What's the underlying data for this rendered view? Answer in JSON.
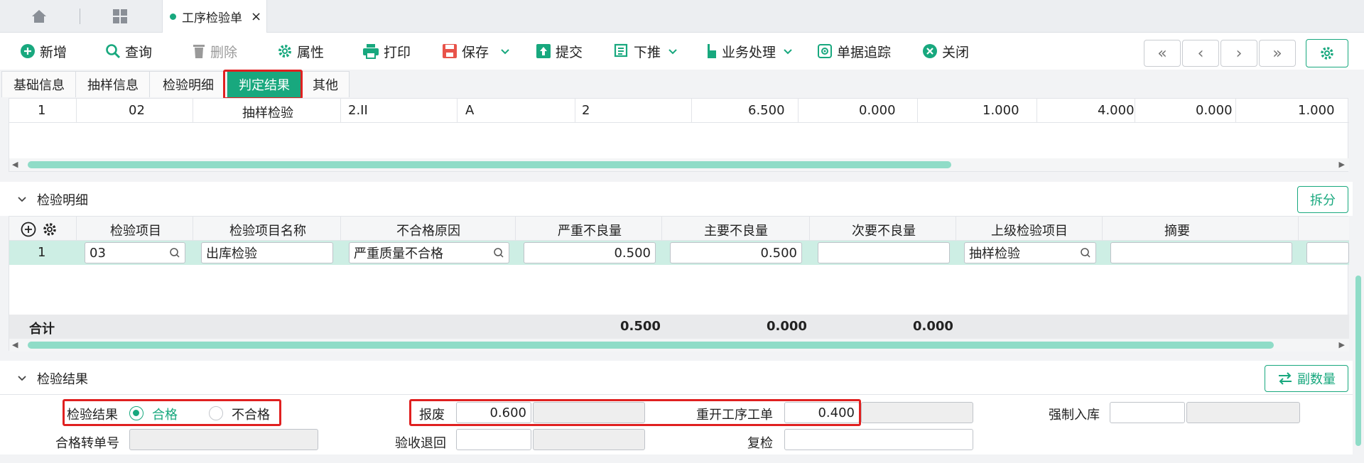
{
  "colors": {
    "accent": "#18a87e",
    "highlight": "#e02020"
  },
  "tabbar": {
    "doc_tab_label": "工序检验单",
    "close_glyph": "×"
  },
  "toolbar": {
    "new": "新增",
    "query": "查询",
    "delete": "删除",
    "props": "属性",
    "print": "打印",
    "save": "保存",
    "submit": "提交",
    "push": "下推",
    "business": "业务处理",
    "trace": "单据追踪",
    "close": "关闭"
  },
  "subtabs": [
    "基础信息",
    "抽样信息",
    "检验明细",
    "判定结果",
    "其他"
  ],
  "sampling_row": {
    "cells": [
      "1",
      "02",
      "抽样检验",
      "2.II",
      "A",
      "2",
      "6.500",
      "0.000",
      "1.000",
      "4.000",
      "0.000",
      "1.000"
    ]
  },
  "detail_section": {
    "title": "检验明细",
    "split_button": "拆分",
    "headers": [
      "检验项目",
      "检验项目名称",
      "不合格原因",
      "严重不良量",
      "主要不良量",
      "次要不良量",
      "上级检验项目",
      "摘要"
    ],
    "row": {
      "seq": "1",
      "item_code": "03",
      "item_name": "出库检验",
      "reason": "严重质量不合格",
      "serious_qty": "0.500",
      "main_qty": "0.500",
      "minor_qty": "",
      "parent_item": "抽样检验",
      "summary": ""
    },
    "total_label": "合计",
    "totals": {
      "serious": "0.500",
      "main": "0.000",
      "minor": "0.000"
    }
  },
  "result_section": {
    "title": "检验结果",
    "qty_button": "副数量",
    "result_label": "检验结果",
    "option_pass": "合格",
    "option_fail": "不合格",
    "scrap_label": "报废",
    "scrap_value": "0.600",
    "reopen_label": "重开工序工单",
    "reopen_value": "0.400",
    "force_label": "强制入库",
    "transfer_label": "合格转单号",
    "return_label": "验收退回",
    "recheck_label": "复检"
  }
}
